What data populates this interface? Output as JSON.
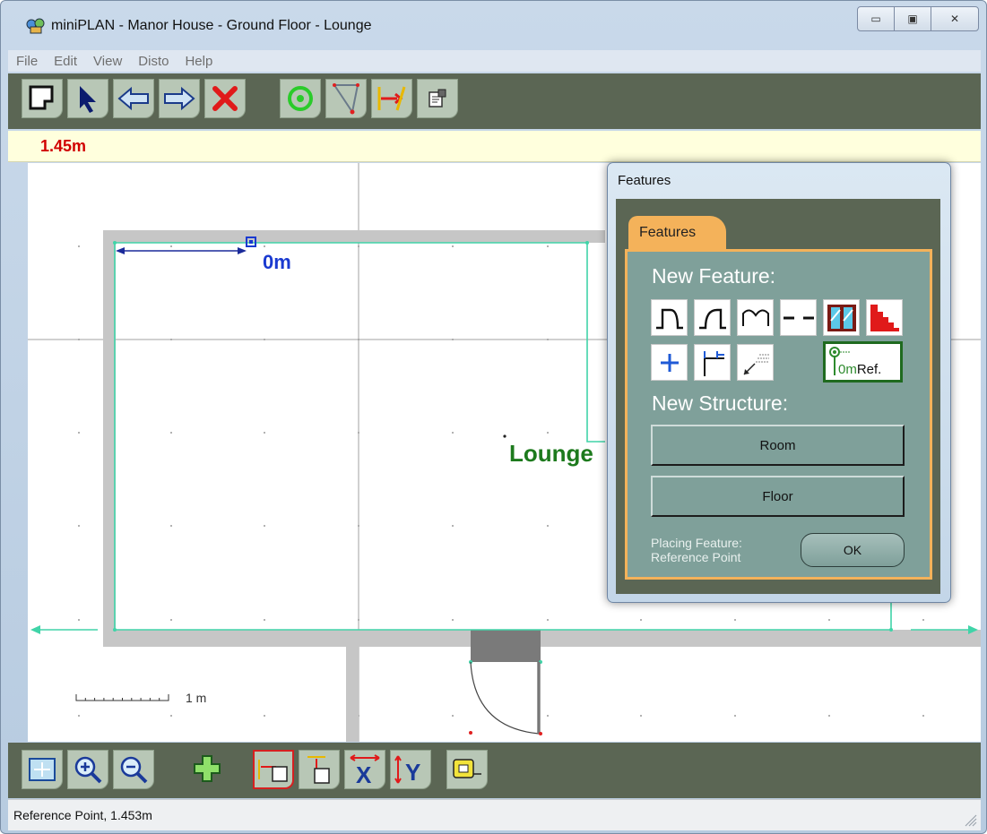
{
  "window": {
    "title": "miniPLAN - Manor House - Ground Floor - Lounge",
    "minimize_glyph": "▭",
    "maximize_glyph": "▣",
    "close_glyph": "✕"
  },
  "menu": [
    "File",
    "Edit",
    "View",
    "Disto",
    "Help"
  ],
  "toolbar": {
    "icons": [
      "new-shape-icon",
      "select-arrow-icon",
      "back-arrow-icon",
      "forward-arrow-icon",
      "delete-x-icon",
      "target-icon",
      "triangle-icon",
      "measure-icon",
      "properties-icon"
    ]
  },
  "measure_bar": {
    "value": "1.45m"
  },
  "plan": {
    "ref_label": "0m",
    "room_label": "Lounge",
    "scale_label": "1 m"
  },
  "features_dialog": {
    "title": "Features",
    "tab": "Features",
    "new_feature_heading": "New Feature:",
    "ref_button_text": "0mRef.",
    "new_structure_heading": "New Structure:",
    "room_button": "Room",
    "floor_button": "Floor",
    "placing_line1": "Placing Feature:",
    "placing_line2": "Reference Point",
    "ok_button": "OK"
  },
  "bottom_toolbar": {
    "icons": [
      "fit-view-icon",
      "zoom-in-icon",
      "zoom-out-icon",
      "add-plus-icon",
      "dimension-width-icon",
      "dimension-height-icon",
      "x-axis-icon",
      "y-axis-icon",
      "tape-measure-icon"
    ]
  },
  "status": {
    "text": "Reference Point, 1.453m"
  },
  "colors": {
    "toolbar_bg": "#5b6654",
    "panel_bg": "#7fa09a",
    "tab_orange": "#f4b25a",
    "accent_red": "#d10000",
    "wall_grey": "#c8c8c8",
    "outline_teal": "#3fd1a6"
  }
}
